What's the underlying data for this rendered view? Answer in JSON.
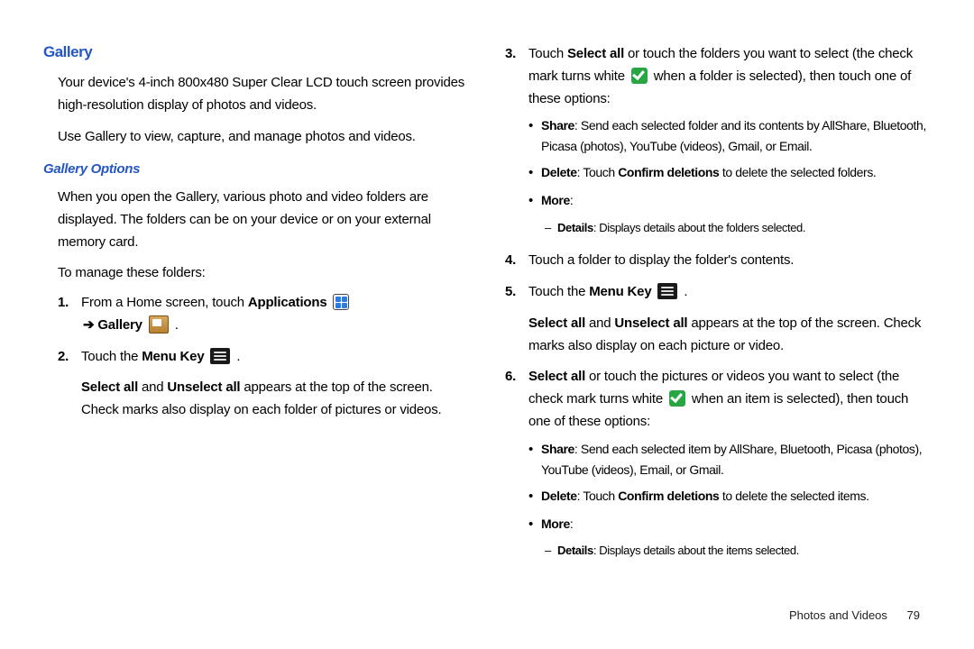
{
  "left": {
    "h1": "Gallery",
    "p1": "Your device's 4-inch 800x480 Super Clear LCD touch screen provides high-resolution display of photos and videos.",
    "p2": "Use Gallery to view, capture, and manage photos and videos.",
    "h2": "Gallery Options",
    "p3": "When you open the Gallery, various photo and video folders are displayed. The folders can be on your device or on your external memory card.",
    "p4": "To manage these folders:",
    "s1a": "From a Home screen, touch ",
    "s1b": "Applications",
    "s1c": "Gallery",
    "s2a": "Touch the ",
    "s2b": "Menu Key",
    "s2p1a": "Select all",
    "s2p1b": " and ",
    "s2p1c": "Unselect all",
    "s2p1d": " appears at the top of the screen. Check marks also display on each folder of pictures or videos."
  },
  "right": {
    "s3a": "Touch ",
    "s3b": "Select all",
    "s3c": " or touch the folders you want to select (the check mark turns white ",
    "s3d": " when a folder is selected), then touch one of these options:",
    "b3_1a": "Share",
    "b3_1b": ": Send each selected folder and its contents by AllShare, Bluetooth, Picasa (photos), YouTube (videos), Gmail, or Email.",
    "b3_2a": "Delete",
    "b3_2b": ": Touch ",
    "b3_2c": "Confirm deletions",
    "b3_2d": " to delete the selected folders.",
    "b3_3a": "More",
    "b3_3b": ":",
    "d3a": "Details",
    "d3b": ": Displays details about the folders selected.",
    "s4": "Touch a folder to display the folder's contents.",
    "s5a": "Touch the ",
    "s5b": "Menu Key",
    "s5p1a": "Select all",
    "s5p1b": " and ",
    "s5p1c": "Unselect all",
    "s5p1d": " appears at the top of the screen. Check marks also display on each picture or video.",
    "s6a": "Select all",
    "s6b": " or touch the pictures or videos you want to select (the check mark turns white ",
    "s6c": " when an item is selected), then touch one of these options:",
    "b6_1a": "Share",
    "b6_1b": ": Send each selected item by AllShare, Bluetooth, Picasa (photos), YouTube (videos), Email, or Gmail.",
    "b6_2a": "Delete",
    "b6_2b": ": Touch ",
    "b6_2c": "Confirm deletions",
    "b6_2d": " to delete the selected items.",
    "b6_3a": "More",
    "b6_3b": ":",
    "d6a": "Details",
    "d6b": ": Displays details about the items selected."
  },
  "footer": {
    "section": "Photos and Videos",
    "page": "79"
  }
}
